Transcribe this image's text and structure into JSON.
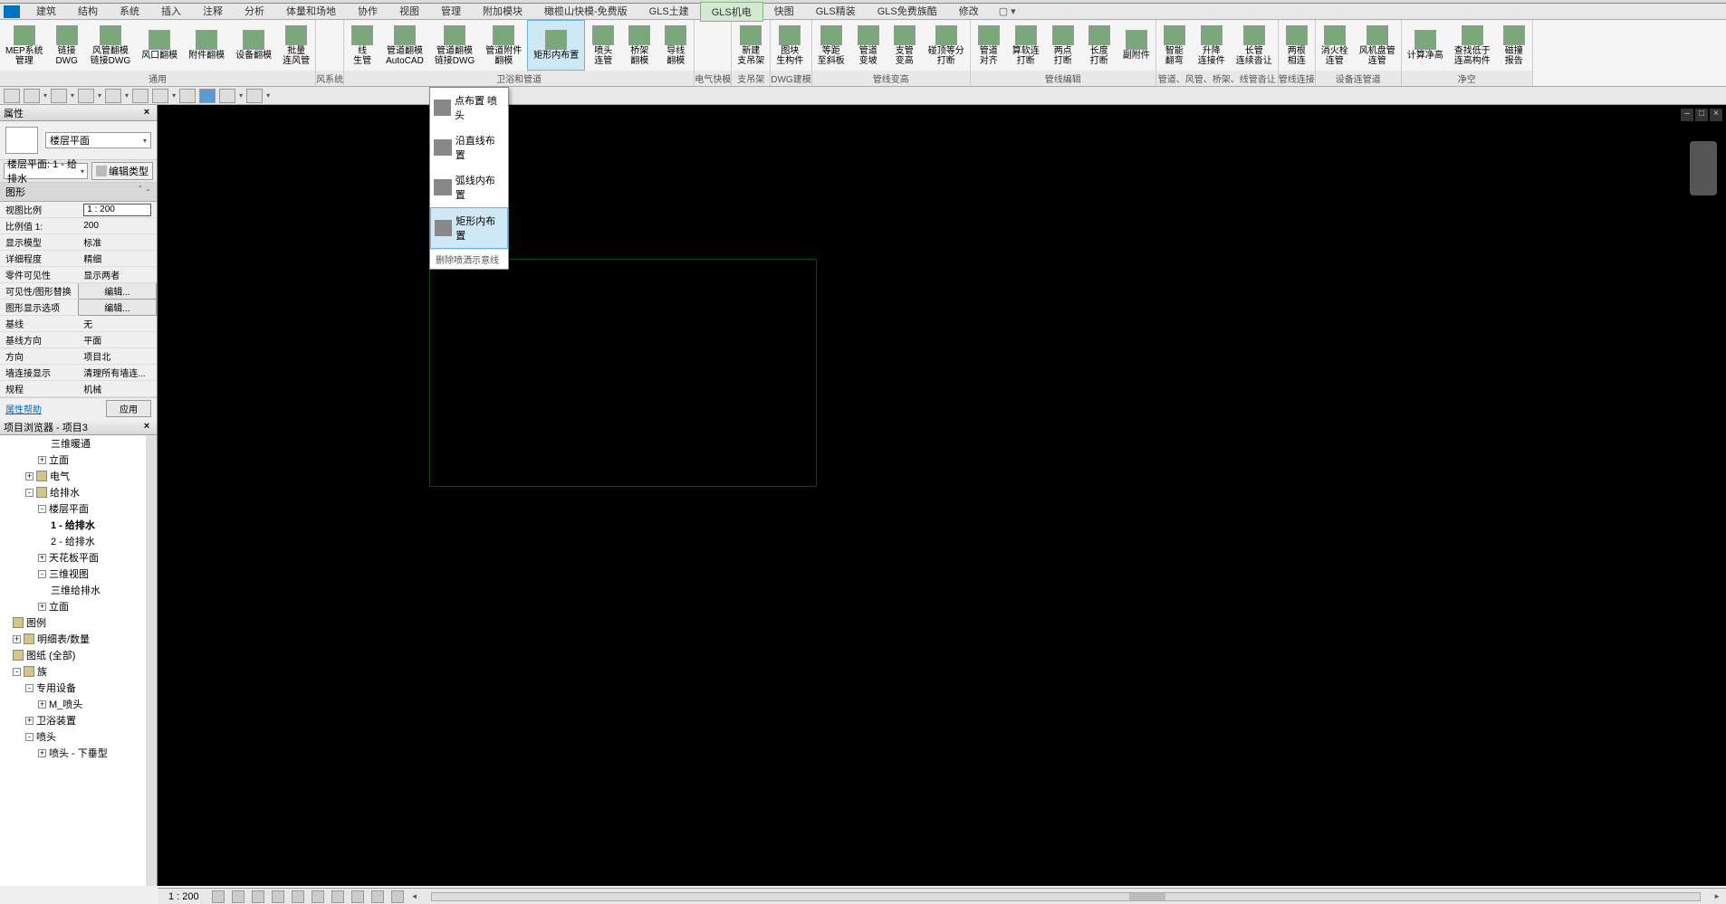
{
  "menu": {
    "items": [
      "建筑",
      "结构",
      "系统",
      "插入",
      "注释",
      "分析",
      "体量和场地",
      "协作",
      "视图",
      "管理",
      "附加模块",
      "橄榄山快模-免费版",
      "GLS土建",
      "GLS机电",
      "快图",
      "GLS精装",
      "GLS免费族酷",
      "修改"
    ],
    "active_index": 13,
    "extra": "▢ ▾"
  },
  "ribbon": {
    "groups": [
      {
        "label": "通用",
        "items": [
          "MEP系统\n管理",
          "链接\nDWG",
          "风管翻模\n链接DWG",
          "风口翻模",
          "附件翻模",
          "设备翻模",
          "批量\n连风管"
        ]
      },
      {
        "label": "风系统",
        "items": []
      },
      {
        "label": "卫浴和管道",
        "items": [
          "线\n生管",
          "管道翻模\nAutoCAD",
          "管道翻模\n链接DWG",
          "管道附件\n翻模",
          "矩形内布置",
          "喷头\n连管",
          "桥架\n翻模",
          "导线\n翻模"
        ]
      },
      {
        "label": "电气快模",
        "items": []
      },
      {
        "label": "支吊架",
        "items": [
          "新建\n支吊架"
        ]
      },
      {
        "label": "DWG建模",
        "items": [
          "图块\n生构件"
        ]
      },
      {
        "label": "管线变高",
        "items": [
          "等距\n至斜板",
          "管道\n变坡",
          "支管\n变高",
          "碰顶等分\n打断"
        ]
      },
      {
        "label": "管线编辑",
        "items": [
          "管道\n对齐",
          "算软连\n打断",
          "两点\n打断",
          "长度\n打断",
          "副附件"
        ]
      },
      {
        "label": "管道、风管、桥架、线管沓让",
        "items": [
          "智能\n翻弯",
          "升降\n连接件",
          "长管\n连续沓让"
        ]
      },
      {
        "label": "管线连接",
        "items": [
          "两根\n相连"
        ]
      },
      {
        "label": "设备连管道",
        "items": [
          "消火栓\n连管",
          "风机盘管\n连管"
        ]
      },
      {
        "label": "净空",
        "items": [
          "计算净高",
          "查找低于\n连高构件",
          "磁撞\n报告"
        ]
      }
    ],
    "active_item": "矩形内布置"
  },
  "dropdown": {
    "items": [
      "点布置 喷头",
      "沿直线布置",
      "弧线内布置",
      "矩形内布置"
    ],
    "active_index": 3,
    "footer": "删除喷洒示意线"
  },
  "properties": {
    "title": "属性",
    "type_label": "楼层平面",
    "instance_dd": "楼层平面: 1 - 给排水",
    "edit_type": "编辑类型",
    "section": "图形",
    "rows": [
      {
        "k": "视图比例",
        "v": "1 : 200",
        "input": true
      },
      {
        "k": "比例值 1:",
        "v": "200"
      },
      {
        "k": "显示模型",
        "v": "标准"
      },
      {
        "k": "详细程度",
        "v": "精细"
      },
      {
        "k": "零件可见性",
        "v": "显示两者"
      },
      {
        "k": "可见性/图形替换",
        "v": "编辑...",
        "btn": true
      },
      {
        "k": "图形显示选项",
        "v": "编辑...",
        "btn": true
      },
      {
        "k": "基线",
        "v": "无"
      },
      {
        "k": "基线方向",
        "v": "平面"
      },
      {
        "k": "方向",
        "v": "项目北"
      },
      {
        "k": "墙连接显示",
        "v": "清理所有墙连..."
      },
      {
        "k": "规程",
        "v": "机械"
      }
    ],
    "help": "属性帮助",
    "apply": "应用"
  },
  "browser": {
    "title": "项目浏览器 - 项目3",
    "items": [
      {
        "indent": 4,
        "label": "三维暖通"
      },
      {
        "indent": 3,
        "label": "立面",
        "toggle": "+"
      },
      {
        "indent": 2,
        "label": "电气",
        "toggle": "+",
        "icon": true
      },
      {
        "indent": 2,
        "label": "给排水",
        "toggle": "-",
        "icon": true
      },
      {
        "indent": 3,
        "label": "楼层平面",
        "toggle": "-"
      },
      {
        "indent": 4,
        "label": "1 - 给排水",
        "bold": true
      },
      {
        "indent": 4,
        "label": "2 - 给排水"
      },
      {
        "indent": 3,
        "label": "天花板平面",
        "toggle": "+"
      },
      {
        "indent": 3,
        "label": "三维视图",
        "toggle": "-"
      },
      {
        "indent": 4,
        "label": "三维给排水"
      },
      {
        "indent": 3,
        "label": "立面",
        "toggle": "+"
      },
      {
        "indent": 1,
        "label": "图例",
        "icon": true
      },
      {
        "indent": 1,
        "label": "明细表/数量",
        "toggle": "+",
        "icon": true
      },
      {
        "indent": 1,
        "label": "图纸 (全部)",
        "icon": true
      },
      {
        "indent": 1,
        "label": "族",
        "toggle": "-",
        "icon": true
      },
      {
        "indent": 2,
        "label": "专用设备",
        "toggle": "-"
      },
      {
        "indent": 3,
        "label": "M_喷头",
        "toggle": "+"
      },
      {
        "indent": 2,
        "label": "卫浴装置",
        "toggle": "+"
      },
      {
        "indent": 2,
        "label": "喷头",
        "toggle": "-"
      },
      {
        "indent": 3,
        "label": "喷头 - 下垂型",
        "toggle": "+"
      }
    ]
  },
  "status": {
    "scale": "1 : 200"
  }
}
